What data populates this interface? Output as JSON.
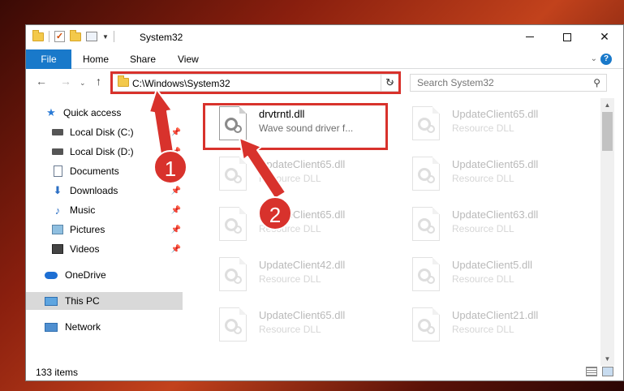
{
  "window": {
    "title": "System32",
    "ribbon_tabs": [
      "File",
      "Home",
      "Share",
      "View"
    ],
    "help": "?",
    "address": "C:\\Windows\\System32",
    "search_placeholder": "Search System32"
  },
  "nav": {
    "items": [
      {
        "label": "Quick access",
        "icon": "star-icon"
      },
      {
        "label": "Local Disk (C:)",
        "icon": "drive-icon",
        "pinned": true
      },
      {
        "label": "Local Disk (D:)",
        "icon": "drive-icon",
        "pinned": true
      },
      {
        "label": "Documents",
        "icon": "documents-icon",
        "pinned": true
      },
      {
        "label": "Downloads",
        "icon": "download-icon",
        "pinned": true
      },
      {
        "label": "Music",
        "icon": "music-icon",
        "pinned": true
      },
      {
        "label": "Pictures",
        "icon": "pictures-icon",
        "pinned": true
      },
      {
        "label": "Videos",
        "icon": "videos-icon",
        "pinned": true
      },
      {
        "label": "OneDrive",
        "icon": "cloud-icon"
      },
      {
        "label": "This PC",
        "icon": "computer-icon",
        "selected": true
      },
      {
        "label": "Network",
        "icon": "network-icon"
      }
    ]
  },
  "files": [
    {
      "name": "drvtrntl.dll",
      "type": "Wave sound driver f..."
    },
    {
      "name": "UpdateClient65.dll",
      "type": "Resource DLL"
    },
    {
      "name": "UpdateClient65.dll",
      "type": "Resource DLL"
    },
    {
      "name": "UpdateClient65.dll",
      "type": "Resource DLL"
    },
    {
      "name": "UpdateClient65.dll",
      "type": "Resource DLL"
    },
    {
      "name": "UpdateClient63.dll",
      "type": "Resource DLL"
    },
    {
      "name": "UpdateClient42.dll",
      "type": "Resource DLL"
    },
    {
      "name": "UpdateClient5.dll",
      "type": "Resource DLL"
    },
    {
      "name": "UpdateClient65.dll",
      "type": "Resource DLL"
    },
    {
      "name": "UpdateClient21.dll",
      "type": "Resource DLL"
    }
  ],
  "status": {
    "item_count": "133 items"
  },
  "annotations": {
    "badge1": "1",
    "badge2": "2",
    "color": "#d8322c"
  }
}
